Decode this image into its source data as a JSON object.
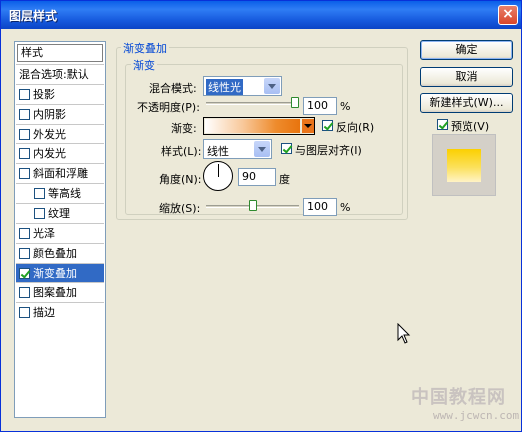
{
  "window": {
    "title": "图层样式",
    "close": "×"
  },
  "sidebar": {
    "header": "样式",
    "items": [
      {
        "label": "混合选项:默认",
        "checkbox": false,
        "checked": false,
        "indent": false
      },
      {
        "label": "投影",
        "checkbox": true,
        "checked": false,
        "indent": false
      },
      {
        "label": "内阴影",
        "checkbox": true,
        "checked": false,
        "indent": false
      },
      {
        "label": "外发光",
        "checkbox": true,
        "checked": false,
        "indent": false
      },
      {
        "label": "内发光",
        "checkbox": true,
        "checked": false,
        "indent": false
      },
      {
        "label": "斜面和浮雕",
        "checkbox": true,
        "checked": false,
        "indent": false
      },
      {
        "label": "等高线",
        "checkbox": true,
        "checked": false,
        "indent": true
      },
      {
        "label": "纹理",
        "checkbox": true,
        "checked": false,
        "indent": true
      },
      {
        "label": "光泽",
        "checkbox": true,
        "checked": false,
        "indent": false
      },
      {
        "label": "颜色叠加",
        "checkbox": true,
        "checked": false,
        "indent": false
      },
      {
        "label": "渐变叠加",
        "checkbox": true,
        "checked": true,
        "indent": false,
        "selected": true
      },
      {
        "label": "图案叠加",
        "checkbox": true,
        "checked": false,
        "indent": false
      },
      {
        "label": "描边",
        "checkbox": true,
        "checked": false,
        "indent": false
      }
    ]
  },
  "panel": {
    "group_title": "渐变叠加",
    "inner_title": "渐变",
    "blend_mode_label": "混合模式:",
    "blend_mode_value": "线性光",
    "opacity_label": "不透明度(P):",
    "opacity_value": "100",
    "opacity_fraction": 1.0,
    "percent": "%",
    "gradient_label": "渐变:",
    "reverse_label": "反向(R)",
    "reverse_checked": true,
    "style_label": "样式(L):",
    "style_value": "线性",
    "align_label": "与图层对齐(I)",
    "align_checked": true,
    "angle_label": "角度(N):",
    "angle_value": "90",
    "angle_unit": "度",
    "scale_label": "缩放(S):",
    "scale_value": "100",
    "scale_fraction": 0.5
  },
  "buttons": {
    "ok": "确定",
    "cancel": "取消",
    "new_style": "新建样式(W)...",
    "preview_label": "预览(V)",
    "preview_checked": true
  },
  "watermark": {
    "title": "中国教程网",
    "url": "www.jcwcn.com"
  },
  "colors": {
    "accent": "#316ac5",
    "gradient_end": "#e8740e",
    "preview_top": "#fbd000"
  }
}
